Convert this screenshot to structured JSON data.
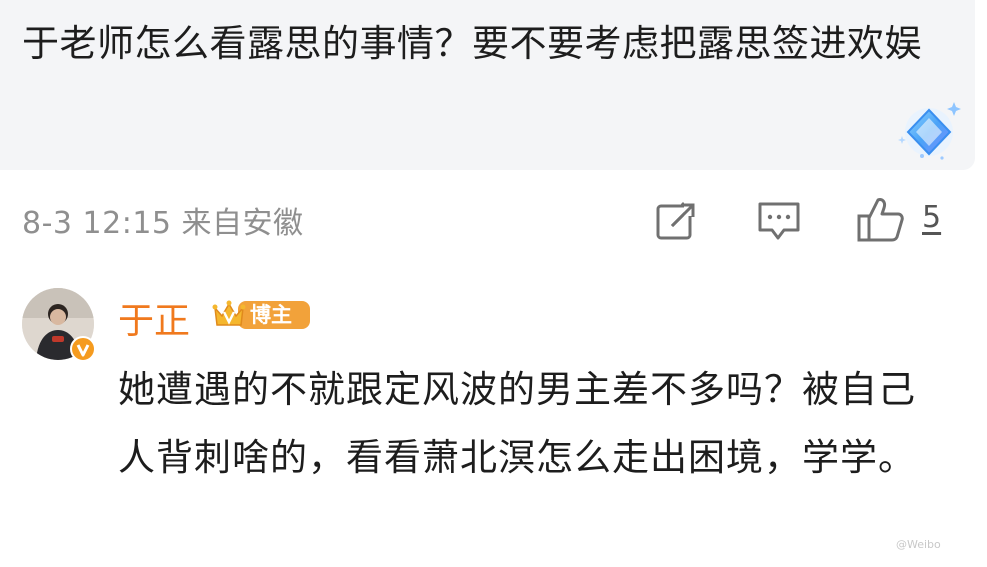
{
  "quoted_comment": {
    "text": "于老师怎么看露思的事情？要不要考虑把露思签进欢娱",
    "meta": "8-3 12:15 来自安徽",
    "like_count": "5"
  },
  "icons": {
    "ai": "sparkle-diamond-icon",
    "share": "share-icon",
    "comment": "comment-icon",
    "like": "thumbs-up-icon",
    "verified": "verified-icon",
    "crown": "crown-icon"
  },
  "reply": {
    "username": "于正",
    "badge_label": "博主",
    "text": "她遭遇的不就跟定风波的男主差不多吗？被自己人背刺啥的，看看萧北溟怎么走出困境，学学。"
  },
  "watermark": "@Weibo",
  "colors": {
    "username": "#f0791d",
    "badge": "#f2a23a",
    "meta_gray": "#8f8f8f",
    "card_bg": "#f4f5f7"
  }
}
